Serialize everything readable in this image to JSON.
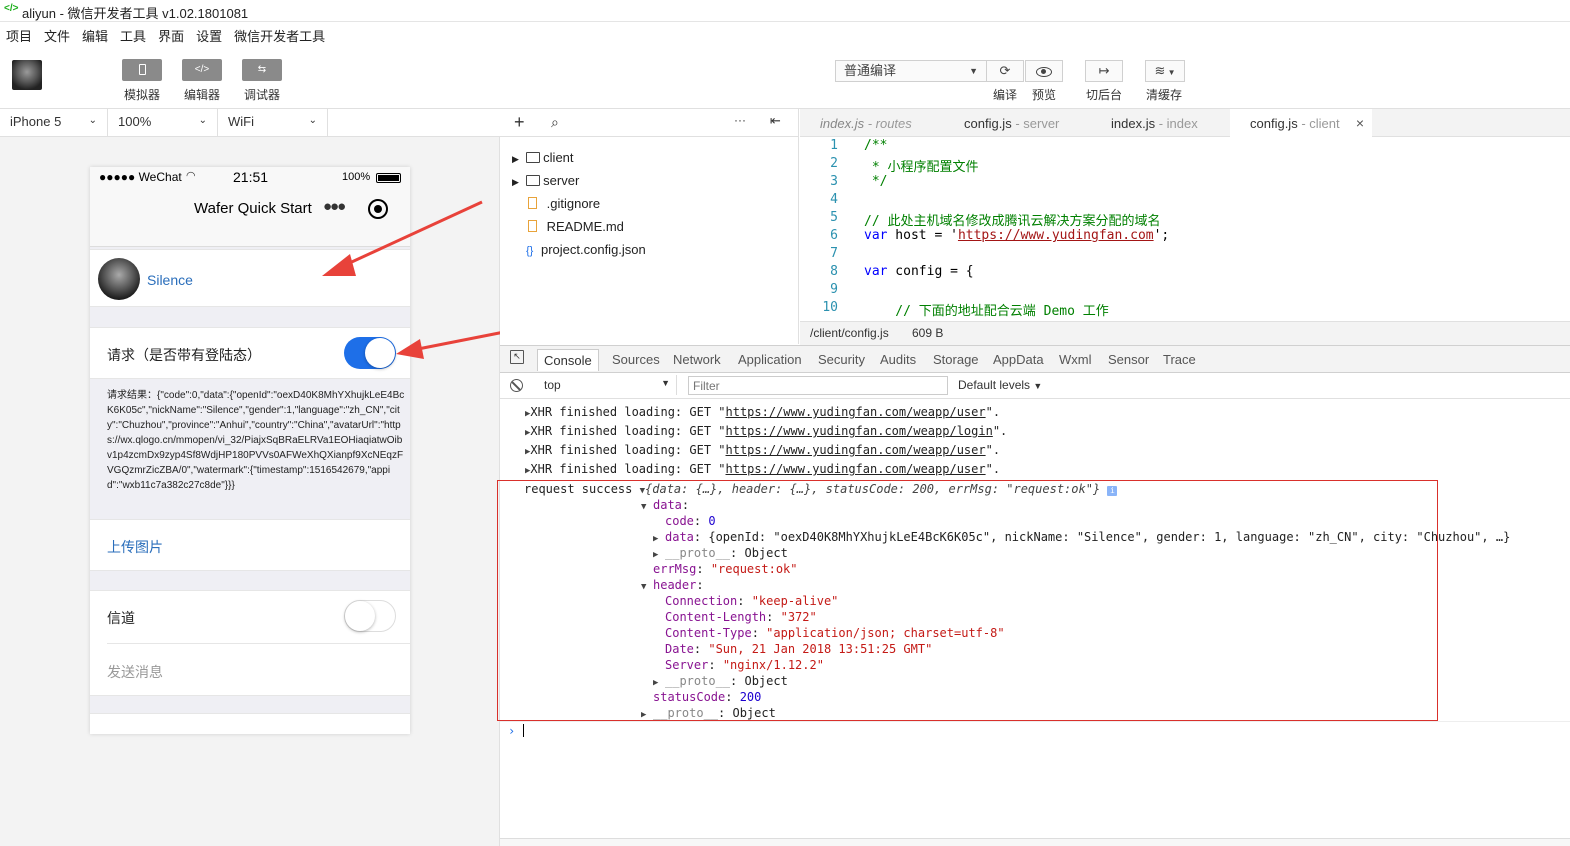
{
  "window": {
    "title": "aliyun - 微信开发者工具 v1.02.1801081"
  },
  "menu": [
    "项目",
    "文件",
    "编辑",
    "工具",
    "界面",
    "设置",
    "微信开发者工具"
  ],
  "toolbar": {
    "left_buttons": [
      {
        "label": "模拟器",
        "icon": "phone-icon"
      },
      {
        "label": "编辑器",
        "icon": "code-icon"
      },
      {
        "label": "调试器",
        "icon": "debug-icon"
      }
    ],
    "compile_mode": "普通编译",
    "right_buttons": [
      {
        "label": "编译",
        "icon": "refresh-icon"
      },
      {
        "label": "预览",
        "icon": "eye-icon"
      },
      {
        "label": "切后台",
        "icon": "background-icon"
      },
      {
        "label": "清缓存",
        "icon": "layers-icon"
      }
    ]
  },
  "device_bar": {
    "device": "iPhone 5",
    "zoom": "100%",
    "network": "WiFi"
  },
  "phone": {
    "status": {
      "carrier": "●●●●● WeChat",
      "time": "21:51",
      "battery": "100%"
    },
    "nav_title": "Wafer Quick Start",
    "user_name": "Silence",
    "request_label": "请求（是否带有登陆态）",
    "request_toggle_on": true,
    "request_result": "请求结果：{\"code\":0,\"data\":{\"openId\":\"oexD40K8MhYXhujkLeE4BcK6K05c\",\"nickName\":\"Silence\",\"gender\":1,\"language\":\"zh_CN\",\"city\":\"Chuzhou\",\"province\":\"Anhui\",\"country\":\"China\",\"avatarUrl\":\"https://wx.qlogo.cn/mmopen/vi_32/PiajxSqBRaELRVa1EOHiaqiatwOibv1p4zcmDx9zyp4Sf8WdjHP180PVVs0AFWeXhQXianpf9XcNEqzFVGQzmrZicZBA/0\",\"watermark\":{\"timestamp\":1516542679,\"appid\":\"wxb11c7a382c27c8de\"}}}",
    "upload_label": "上传图片",
    "channel_label": "信道",
    "channel_toggle_on": false,
    "send_label": "发送消息"
  },
  "file_tree": [
    {
      "name": "client",
      "type": "folder"
    },
    {
      "name": "server",
      "type": "folder"
    },
    {
      "name": ".gitignore",
      "type": "file"
    },
    {
      "name": "README.md",
      "type": "file"
    },
    {
      "name": "project.config.json",
      "type": "json"
    }
  ],
  "editor_tabs": [
    {
      "file": "index.js",
      "suffix": " - routes",
      "italic": true
    },
    {
      "file": "config.js",
      "suffix": " - server"
    },
    {
      "file": "index.js",
      "suffix": " - index"
    },
    {
      "file": "config.js",
      "suffix": " - client",
      "active": true
    }
  ],
  "code_lines": [
    {
      "n": "1",
      "text": "/**",
      "cls": "comment"
    },
    {
      "n": "2",
      "text": " * 小程序配置文件",
      "cls": "comment"
    },
    {
      "n": "3",
      "text": " */",
      "cls": "comment"
    },
    {
      "n": "4",
      "text": "",
      "cls": ""
    },
    {
      "n": "5",
      "text": "// 此处主机域名修改成腾讯云解决方案分配的域名",
      "cls": "comment"
    },
    {
      "n": "6",
      "text": "var host = 'https://www.yudingfan.com';",
      "cls": "code"
    },
    {
      "n": "7",
      "text": "",
      "cls": ""
    },
    {
      "n": "8",
      "text": "var config = {",
      "cls": "code"
    },
    {
      "n": "9",
      "text": "",
      "cls": ""
    },
    {
      "n": "10",
      "text": "    // 下面的地址配合云端 Demo 工作",
      "cls": "comment"
    }
  ],
  "editor_status": {
    "path": "/client/config.js",
    "size": "609 B"
  },
  "devtools_tabs": [
    "Console",
    "Sources",
    "Network",
    "Application",
    "Security",
    "Audits",
    "Storage",
    "AppData",
    "Wxml",
    "Sensor",
    "Trace"
  ],
  "console_filter": {
    "context": "top",
    "placeholder": "Filter",
    "levels": "Default levels"
  },
  "console_lines": {
    "xhr": [
      {
        "prefix": "XHR finished loading: GET \"",
        "url": "https://www.yudingfan.com/weapp/user",
        "suffix": "\"."
      },
      {
        "prefix": "XHR finished loading: GET \"",
        "url": "https://www.yudingfan.com/weapp/login",
        "suffix": "\"."
      },
      {
        "prefix": "XHR finished loading: GET \"",
        "url": "https://www.yudingfan.com/weapp/user",
        "suffix": "\"."
      },
      {
        "prefix": "XHR finished loading: GET \"",
        "url": "https://www.yudingfan.com/weapp/user",
        "suffix": "\"."
      }
    ],
    "request_label": "request success",
    "request_summary": "{data: {…}, header: {…}, statusCode: 200, errMsg: \"request:ok\"}",
    "tree": [
      {
        "key": "data",
        "val": "",
        "indent": 1,
        "arrow": "down"
      },
      {
        "key": "code",
        "val": "0",
        "indent": 2,
        "arrow": ""
      },
      {
        "key": "data",
        "val": "{openId: \"oexD40K8MhYXhujkLeE4BcK6K05c\", nickName: \"Silence\", gender: 1, language: \"zh_CN\", city: \"Chuzhou\", …}",
        "indent": 2,
        "arrow": "right"
      },
      {
        "key": "__proto__",
        "val": "Object",
        "indent": 2,
        "arrow": "right"
      },
      {
        "key": "errMsg",
        "val": "\"request:ok\"",
        "indent": 1,
        "arrow": ""
      },
      {
        "key": "header",
        "val": "",
        "indent": 1,
        "arrow": "down"
      },
      {
        "key": "Connection",
        "val": "\"keep-alive\"",
        "indent": 2,
        "arrow": ""
      },
      {
        "key": "Content-Length",
        "val": "\"372\"",
        "indent": 2,
        "arrow": ""
      },
      {
        "key": "Content-Type",
        "val": "\"application/json; charset=utf-8\"",
        "indent": 2,
        "arrow": ""
      },
      {
        "key": "Date",
        "val": "\"Sun, 21 Jan 2018 13:51:25 GMT\"",
        "indent": 2,
        "arrow": ""
      },
      {
        "key": "Server",
        "val": "\"nginx/1.12.2\"",
        "indent": 2,
        "arrow": ""
      },
      {
        "key": "__proto__",
        "val": "Object",
        "indent": 2,
        "arrow": "right"
      },
      {
        "key": "statusCode",
        "val": "200",
        "indent": 1,
        "arrow": ""
      },
      {
        "key": "__proto__",
        "val": "Object",
        "indent": 1,
        "arrow": "right"
      }
    ]
  },
  "colors": {
    "accent": "#1a73e8",
    "toggle_on": "#1e6fe8",
    "annotation": "#e8423a",
    "link": "#2a6ebb"
  }
}
